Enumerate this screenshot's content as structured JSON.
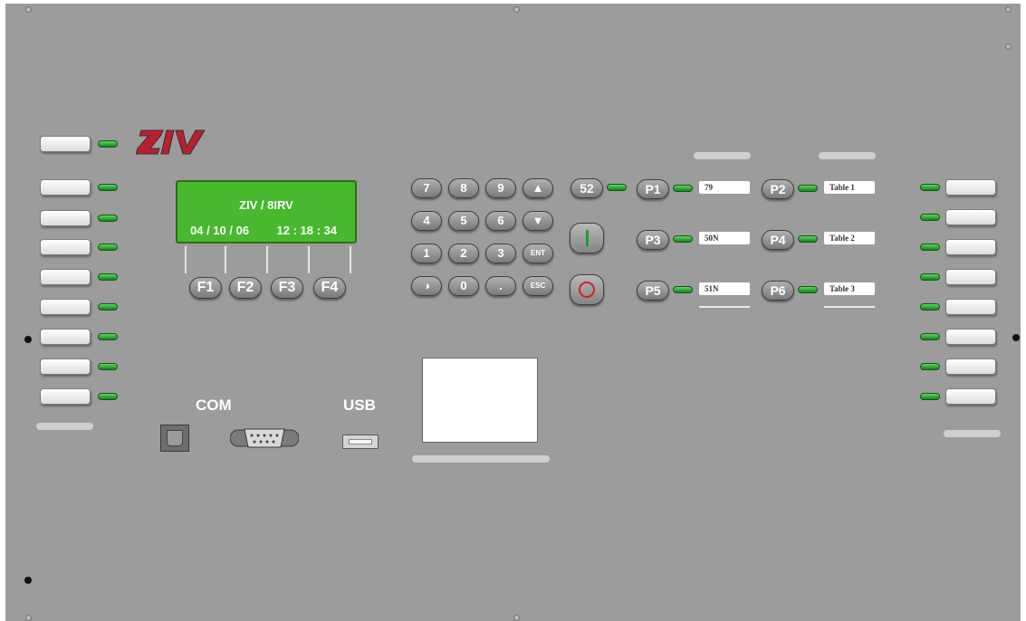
{
  "device": {
    "logo_text": "ZIV",
    "brand_color": "#b8202e",
    "lcd": {
      "title": "ZIV / 8IRV",
      "date": "04 / 10 / 06",
      "time": "12 : 18 : 34",
      "color": "#48b82e"
    },
    "function_keys": [
      "F1",
      "F2",
      "F3",
      "F4"
    ],
    "keypad": {
      "row1": [
        "7",
        "8",
        "9",
        "▲"
      ],
      "row2": [
        "4",
        "5",
        "6",
        "▼"
      ],
      "row3": [
        "1",
        "2",
        "3",
        "ENT"
      ],
      "row4": [
        "◑",
        "0",
        ".",
        "ESC"
      ]
    },
    "breaker_key": "52",
    "close_symbol": "I",
    "open_symbol": "O",
    "programmable_keys": [
      {
        "key": "P1",
        "label": "79"
      },
      {
        "key": "P2",
        "label": "Table 1"
      },
      {
        "key": "P3",
        "label": "50N"
      },
      {
        "key": "P4",
        "label": "Table 2"
      },
      {
        "key": "P5",
        "label": "51N"
      },
      {
        "key": "P6",
        "label": "Table 3"
      }
    ],
    "ports": {
      "com_label": "COM",
      "usb_label": "USB"
    },
    "led_color": "#2aa832"
  }
}
